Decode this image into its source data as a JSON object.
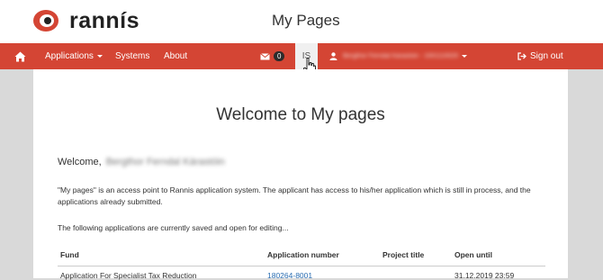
{
  "header": {
    "logo_text": "rannís",
    "site_title": "My Pages"
  },
  "nav": {
    "applications_label": "Applications",
    "systems_label": "Systems",
    "about_label": "About",
    "messages_count": "0",
    "language_label": "IS",
    "user_label": "Bergthor Ferndal Kárastóin - 1001110020",
    "signout_label": "Sign out"
  },
  "main": {
    "heading": "Welcome to My pages",
    "greeting_label": "Welcome,",
    "greeting_name": "Bergthor Ferndal Kárastóin",
    "intro_text": "\"My pages\" is an access point to Rannis application system. The applicant has access to his/her application which is still in process, and the applications already submitted.",
    "open_note": "The following applications are currently saved and open for editing..."
  },
  "table": {
    "headers": {
      "fund": "Fund",
      "app_number": "Application number",
      "project_title": "Project title",
      "open_until": "Open until"
    },
    "rows": [
      {
        "fund": "Application For Specialist Tax Reduction",
        "app_number": "180264-8001",
        "project_title": "",
        "open_until": "31.12.2019 23:59"
      }
    ]
  },
  "colors": {
    "brand_red": "#d44534",
    "link_blue": "#2a6db2"
  }
}
